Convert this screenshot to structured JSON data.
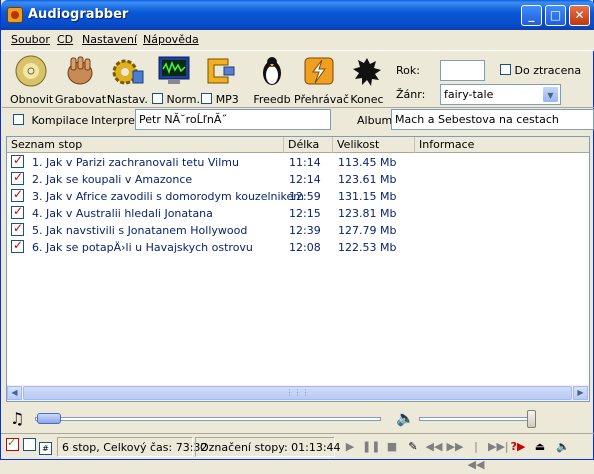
{
  "window": {
    "title": "Audiograbber"
  },
  "menu": [
    "Soubor",
    "CD",
    "Nastavení",
    "Nápověda"
  ],
  "toolbar": {
    "refresh": "Obnovit",
    "grab": "Grabovat!",
    "settings": "Nastav.",
    "norm": "Norm.",
    "mp3": "MP3",
    "freedb": "Freedb",
    "player": "Přehrávač",
    "exit": "Konec"
  },
  "fields": {
    "year_label": "Rok:",
    "year_value": "",
    "lost_label": "Do ztracena",
    "genre_label": "Žánr:",
    "genre_value": "fairy-tale",
    "compilation_label": "Kompilace",
    "artist_label": "Interpret",
    "artist_value": "Petr NĂ˘roĹľnĂ˝",
    "album_label": "Album",
    "album_value": "Mach a Sebestova na cestach"
  },
  "table": {
    "columns": [
      "Seznam stop",
      "Délka",
      "Velikost",
      "Informace"
    ],
    "rows": [
      {
        "title": "1. Jak v Parizi zachranovali tetu Vilmu",
        "length": "11:14",
        "size": "113.45 Mb",
        "info": ""
      },
      {
        "title": "2. Jak se koupali v Amazonce",
        "length": "12:14",
        "size": "123.61 Mb",
        "info": ""
      },
      {
        "title": "3. Jak v Africe zavodili s domorodym kouzelnikem",
        "length": "12:59",
        "size": "131.15 Mb",
        "info": ""
      },
      {
        "title": "4. Jak v Australii hledali Jonatana",
        "length": "12:15",
        "size": "123.81 Mb",
        "info": ""
      },
      {
        "title": "5. Jak navstivili s Jonatanem Hollywood",
        "length": "12:39",
        "size": "127.79 Mb",
        "info": ""
      },
      {
        "title": "6. Jak se potapÄ›li u Havajskych ostrovu",
        "length": "12:08",
        "size": "122.53 Mb",
        "info": ""
      }
    ]
  },
  "status": {
    "summary": "6 stop, Celkový čas: 73:32",
    "selected": "Označení stopy: 01:13:44"
  }
}
